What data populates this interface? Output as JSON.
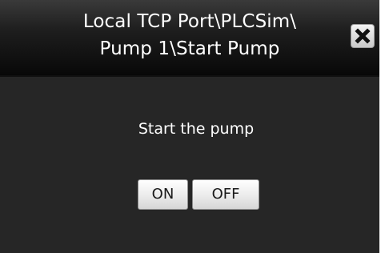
{
  "dialog": {
    "title_line1": "Local TCP Port\\PLCSim\\",
    "title_line2": "Pump 1\\Start Pump",
    "close_icon": "close-icon",
    "message": "Start the pump",
    "buttons": {
      "on_label": "ON",
      "off_label": "OFF"
    }
  },
  "colors": {
    "background": "#262626",
    "titlebar": "#0a0a0a",
    "text": "#ffffff",
    "button_face": "#ededed"
  }
}
